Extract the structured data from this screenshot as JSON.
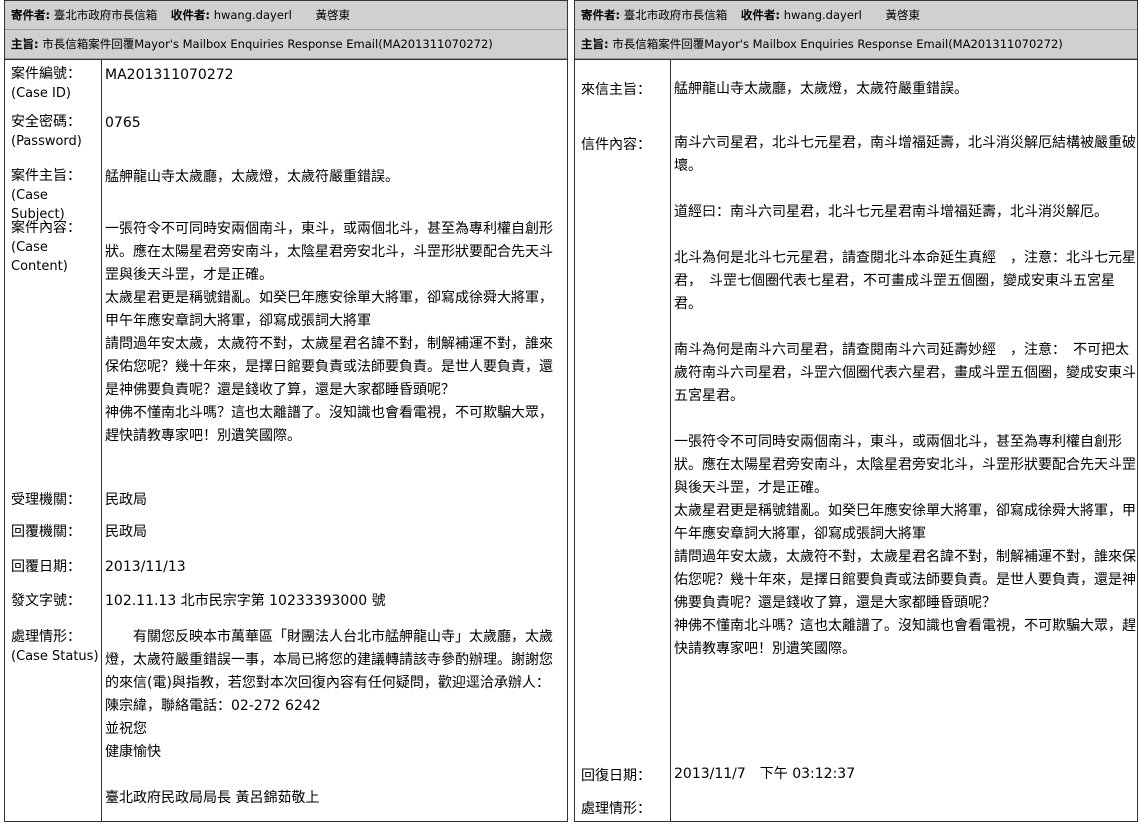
{
  "left": {
    "sender_label": "寄件者:",
    "sender_value": "臺北市政府市長信箱",
    "recipient_label": "收件者:",
    "recipient_value": "hwang.dayerl",
    "recipient_name": "黃啓東",
    "subject_label": "主旨:",
    "subject_value": "市長信箱案件回覆Mayor's Mailbox Enquiries Response Email(MA201311070272)",
    "case_id_label": "案件編號：",
    "case_id_en": "(Case ID)",
    "case_id_value": "MA201311070272",
    "password_label": "安全密碼：",
    "password_en": "(Password)",
    "password_value": "0765",
    "case_subject_label": "案件主旨：",
    "case_subject_en": "(Case Subject)",
    "case_subject_value": "艋舺龍山寺太歲廳，太歲燈，太歲符嚴重錯誤。",
    "case_content_label": "案件內容：",
    "case_content_en": "(Case Content)",
    "case_content_value": "一張符令不可同時安兩個南斗，東斗，或兩個北斗，甚至為專利權自創形狀。應在太陽星君旁安南斗，太陰星君旁安北斗，斗罡形狀要配合先天斗罡與後天斗罡，才是正確。\n太歲星君更是稱號錯亂。如癸巳年應安徐單大將軍，卻寫成徐舜大將軍，甲午年應安章詞大將軍，卻寫成張詞大將軍\n請問過年安太歲，太歲符不對，太歲星君名諱不對，制解補運不對，誰來保佑您呢？幾十年來，是擇日館要負責或法師要負責。是世人要負責，還是神佛要負責呢？還是錢收了算，還是大家都睡昏頭呢？\n神佛不懂南北斗嗎？這也太離譜了。沒知識也會看電視，不可欺騙大眾，趕快請教專家吧！別遺笑國際。",
    "agency_label": "受理機關：",
    "agency_value": "民政局",
    "reply_agency_label": "回覆機關：",
    "reply_agency_value": "民政局",
    "reply_date_label": "回覆日期：",
    "reply_date_value": "2013/11/13",
    "doc_no_label": "發文字號：",
    "doc_no_value": "102.11.13 北市民宗字第 10233393000 號",
    "status_label": "處理情形：",
    "status_en": "(Case Status)",
    "status_value": "　　有關您反映本市萬華區「財團法人台北市艋舺龍山寺」太歲廳，太歲燈，太歲符嚴重錯誤一事，本局已將您的建議轉請該寺參酌辦理。謝謝您的來信(電)與指教，若您對本次回復內容有任何疑問，歡迎逕洽承辦人：陳宗緯，聯絡電話：02-272 6242\n並祝您\n健康愉快\n\n臺北政府民政局局長 黃呂錦茹敬上"
  },
  "right": {
    "sender_label": "寄件者:",
    "sender_value": "臺北市政府市長信箱",
    "recipient_label": "收件者:",
    "recipient_value": "hwang.dayerl",
    "recipient_name": "黃啓東",
    "subject_label": "主旨:",
    "subject_value": "市長信箱案件回覆Mayor's Mailbox Enquiries Response Email(MA201311070272)",
    "mail_subject_label": "來信主旨：",
    "mail_subject_value": "艋舺龍山寺太歲廳，太歲燈，太歲符嚴重錯誤。",
    "mail_content_label": "信件內容：",
    "mail_content_value": "南斗六司星君，北斗七元星君，南斗增福延壽，北斗消災解厄結構被嚴重破壞。\n\n道經曰：南斗六司星君，北斗七元星君南斗增福延壽，北斗消災解厄。\n\n北斗為何是北斗七元星君，請查閱北斗本命延生真經　，注意：北斗七元星君，　斗罡七個圈代表七星君，不可畫成斗罡五個圈，變成安東斗五宮星君。\n\n南斗為何是南斗六司星君，請查閱南斗六司延壽妙經　，注意：　不可把太歲符南斗六司星君，斗罡六個圈代表六星君，畫成斗罡五個圈，變成安東斗五宮星君。\n\n一張符令不可同時安兩個南斗，東斗，或兩個北斗，甚至為專利權自創形狀。應在太陽星君旁安南斗，太陰星君旁安北斗，斗罡形狀要配合先天斗罡與後天斗罡，才是正確。\n太歲星君更是稱號錯亂。如癸巳年應安徐單大將軍，卻寫成徐舜大將軍，甲午年應安章詞大將軍，卻寫成張詞大將軍\n請問過年安太歲，太歲符不對，太歲星君名諱不對，制解補運不對，誰來保佑您呢？幾十年來，是擇日館要負責或法師要負責。是世人要負責，還是神佛要負責呢？還是錢收了算，還是大家都睡昏頭呢？\n神佛不懂南北斗嗎？這也太離譜了。沒知識也會看電視，不可欺騙大眾，趕快請教專家吧！別遺笑國際。",
    "reply_date_label": "回復日期：",
    "reply_date_value": "2013/11/7　下午 03:12:37",
    "status_label": "處理情形："
  }
}
